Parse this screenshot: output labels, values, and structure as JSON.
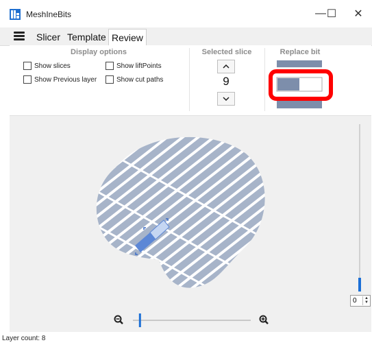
{
  "window": {
    "title": "MeshInеBits",
    "minimize_glyph": "—",
    "maximize_glyph": "☐",
    "close_glyph": "✕"
  },
  "tabs": [
    {
      "label": "Slicer",
      "active": false
    },
    {
      "label": "Template",
      "active": false
    },
    {
      "label": "Review",
      "active": true
    }
  ],
  "display_options": {
    "title": "Display options",
    "show_slices": "Show slices",
    "show_lift_points": "Show liftPoints",
    "show_previous_layer": "Show Previous layer",
    "show_cut_paths": "Show cut paths"
  },
  "selected_slice": {
    "title": "Selected slice",
    "value": "9"
  },
  "replace_bit": {
    "title": "Replace bit"
  },
  "zoom": {
    "level_fraction": 0.06
  },
  "layer_slider": {
    "value": "0"
  },
  "status": {
    "layer_count": "Layer count: 8"
  },
  "colors": {
    "bit_fill": "#a7b4c9",
    "bit_selected": "#5c87d6",
    "bit_selected_light": "#c5d6f2",
    "highlight_red": "#ff0000",
    "replace_bit_dark": "#7d8eab",
    "slider_blue": "#1b6fd6"
  },
  "icons": {
    "zoom_out": "zoom-out-icon",
    "zoom_in": "zoom-in-icon",
    "menu": "hamburger-menu-icon",
    "app": "app-icon"
  }
}
